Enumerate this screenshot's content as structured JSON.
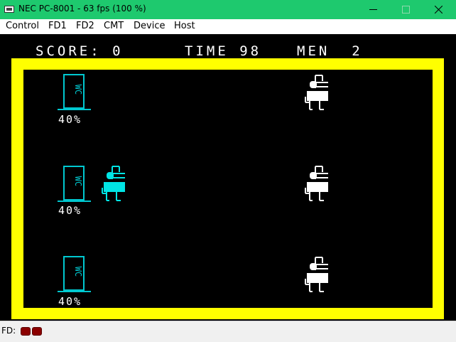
{
  "window": {
    "title": "NEC PC-8001 - 63 fps (100 %)",
    "titlebar_color": "#1ec96e"
  },
  "menu": {
    "items": [
      "Control",
      "FD1",
      "FD2",
      "CMT",
      "Device",
      "Host"
    ]
  },
  "game": {
    "score_label": "SCORE:",
    "score_value": "0",
    "time_label": "TIME",
    "time_value": "98",
    "men_label": "MEN",
    "men_value": "2",
    "toilet_text": "WC",
    "toilets": [
      {
        "percent": "40%"
      },
      {
        "percent": "40%"
      },
      {
        "percent": "40%"
      }
    ],
    "colors": {
      "border": "#ffff00",
      "player": "#00e5e5",
      "toilet": "#00c8d0",
      "enemy": "#ffffff",
      "background": "#000000"
    }
  },
  "status": {
    "fd_label": "FD:",
    "led_color": "#8b0000"
  }
}
